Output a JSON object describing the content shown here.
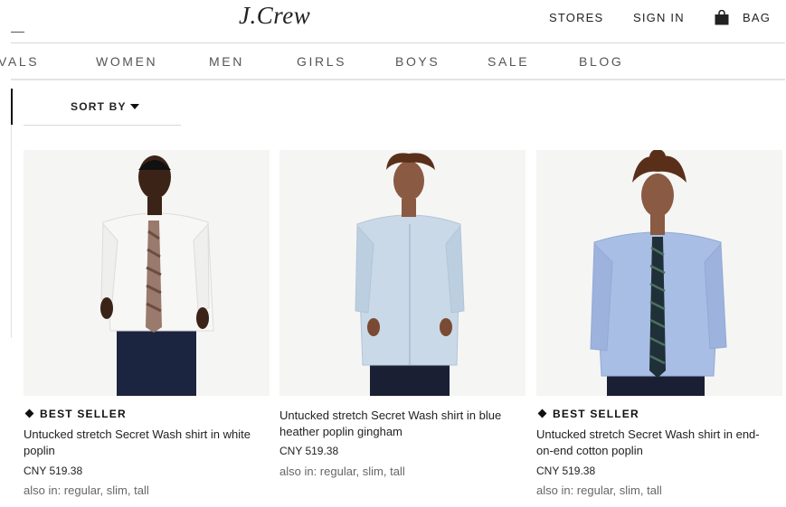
{
  "header": {
    "logo": "J.Crew",
    "stores": "STORES",
    "sign_in": "SIGN IN",
    "bag": "BAG"
  },
  "nav": {
    "items": [
      "VALS",
      "WOMEN",
      "MEN",
      "GIRLS",
      "BOYS",
      "SALE",
      "BLOG"
    ]
  },
  "sort": {
    "label": "SORT BY"
  },
  "products": [
    {
      "badge": "BEST SELLER",
      "name_line1": "Untucked stretch Secret Wash shirt in white",
      "name_line2": "poplin",
      "price": "CNY 519.38",
      "also": "also in: regular, slim, tall",
      "shirt_color": "#f6f6f4",
      "tie": "stripe-brown"
    },
    {
      "badge": "",
      "name_line1": "Untucked stretch Secret Wash shirt in blue",
      "name_line2": "heather poplin gingham",
      "price": "CNY 519.38",
      "also": "also in: regular, slim, tall",
      "shirt_color": "#c8d8e6"
    },
    {
      "badge": "BEST SELLER",
      "name_line1": "Untucked stretch Secret Wash shirt in end-",
      "name_line2": "on-end cotton poplin",
      "price": "CNY 519.38",
      "also": "also in: regular, slim, tall",
      "shirt_color": "#a8bde3",
      "tie": "stripe-navy"
    }
  ]
}
